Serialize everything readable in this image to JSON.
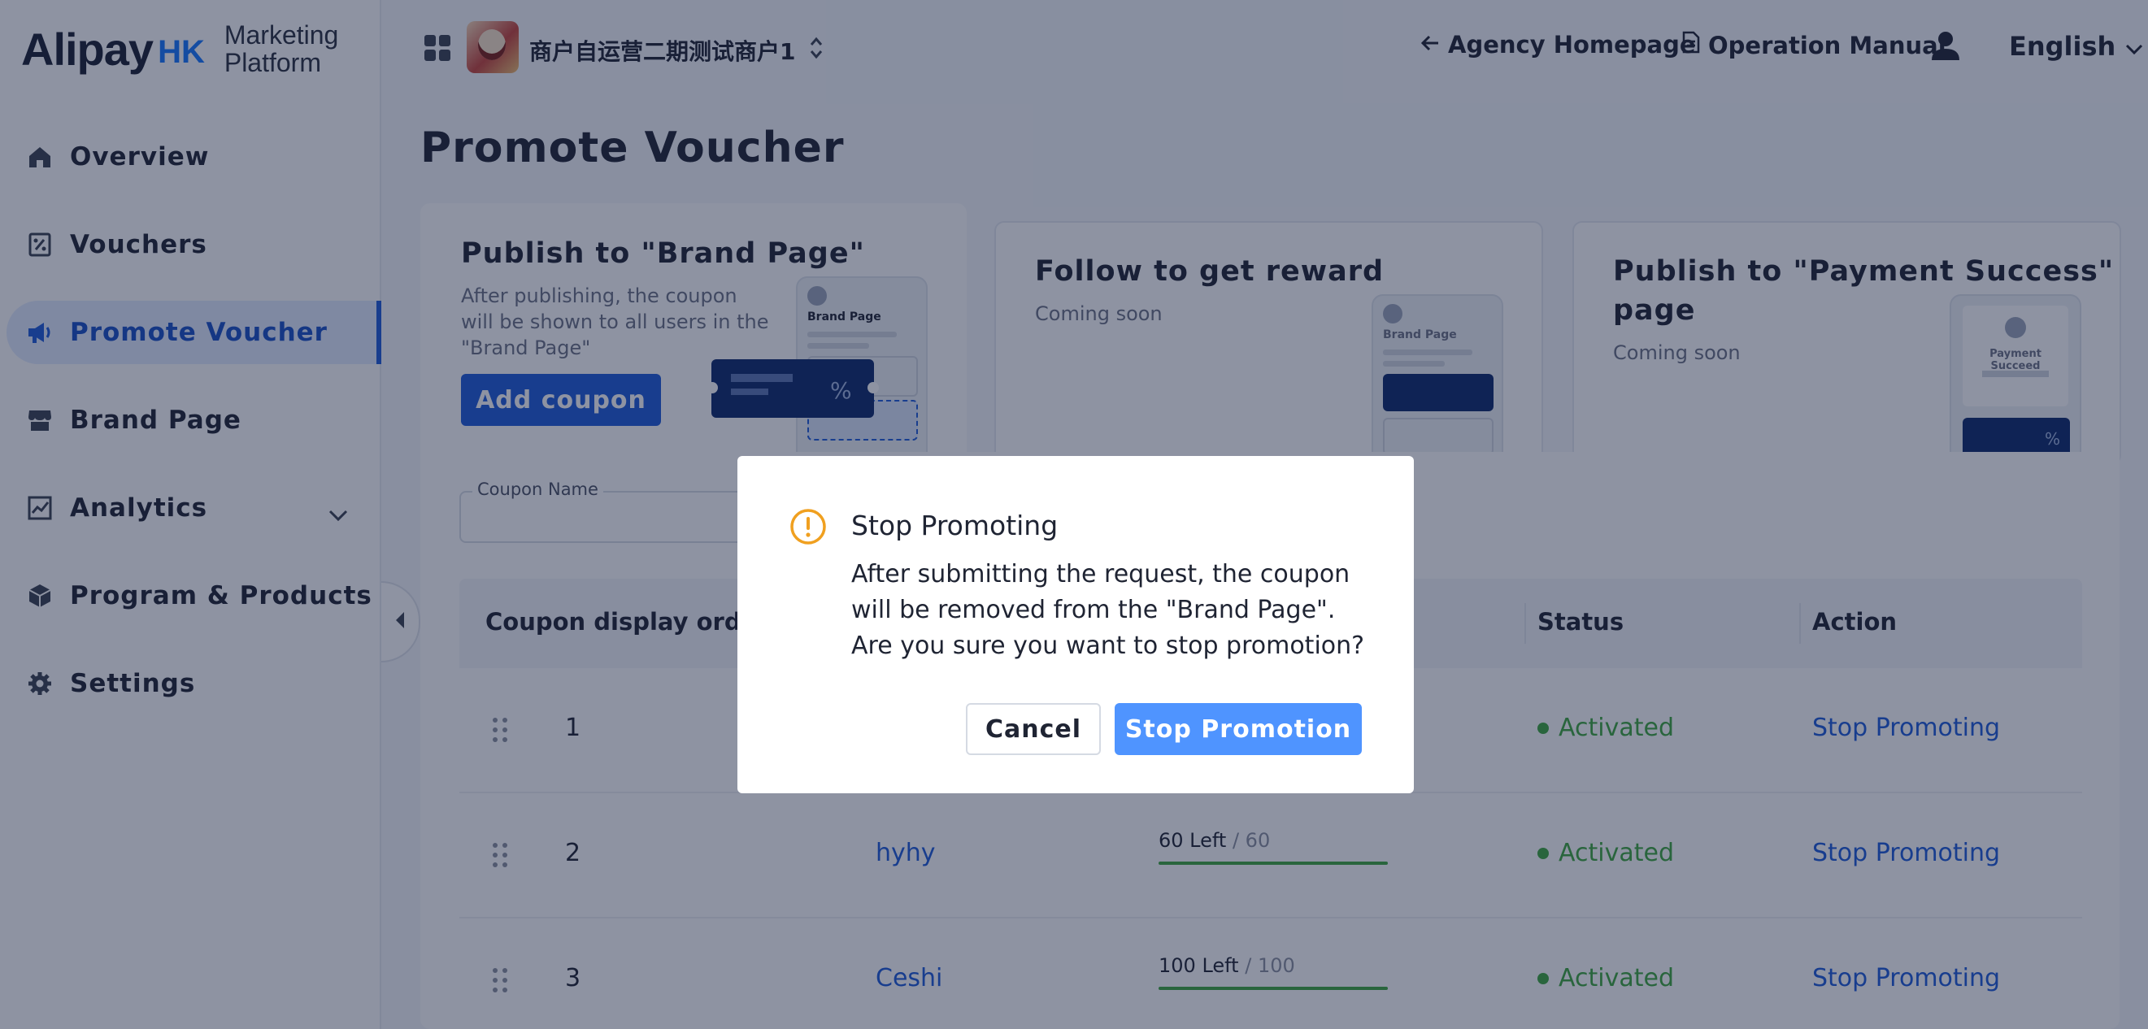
{
  "logo": {
    "main": "Alipay",
    "region": "HK",
    "sub_line1": "Marketing",
    "sub_line2": "Platform"
  },
  "sidebar": {
    "items": [
      {
        "label": "Overview",
        "icon": "home-icon"
      },
      {
        "label": "Vouchers",
        "icon": "voucher-icon"
      },
      {
        "label": "Promote Voucher",
        "icon": "megaphone-icon",
        "active": true
      },
      {
        "label": "Brand Page",
        "icon": "store-icon"
      },
      {
        "label": "Analytics",
        "icon": "chart-icon",
        "expandable": true
      },
      {
        "label": "Program & Products",
        "icon": "box-icon"
      },
      {
        "label": "Settings",
        "icon": "gear-icon"
      }
    ]
  },
  "header": {
    "store_name": "商户自运营二期测试商户1",
    "agency_link": "Agency Homepage",
    "manual_link": "Operation Manual",
    "language": "English"
  },
  "page": {
    "title": "Promote Voucher"
  },
  "cards": [
    {
      "title": "Publish to \"Brand Page\"",
      "desc": "After publishing, the coupon will be shown to all users in the \"Brand Page\"",
      "button": "Add coupon",
      "illustration_title": "Brand Page",
      "coupon_symbol": "%"
    },
    {
      "title": "Follow to get reward",
      "desc": "Coming soon",
      "illustration_title": "Brand Page"
    },
    {
      "title_line1": "Publish to \"Payment Success\"",
      "title_line2": "page",
      "desc": "Coming soon",
      "illustration_title": "Payment Succeed",
      "coupon_symbol": "%"
    }
  ],
  "filter": {
    "coupon_name_label": "Coupon Name"
  },
  "table": {
    "headers": {
      "order": "Coupon display order",
      "status": "Status",
      "action": "Action"
    },
    "rows": [
      {
        "order": "1",
        "name": "",
        "stock": "",
        "total": "",
        "fill": 1,
        "status": "Activated",
        "action": "Stop Promoting"
      },
      {
        "order": "2",
        "name": "hyhy",
        "stock": "60 Left",
        "total": " / 60",
        "fill": 1,
        "status": "Activated",
        "action": "Stop Promoting"
      },
      {
        "order": "3",
        "name": "Ceshi",
        "stock": "100 Left",
        "total": " / 100",
        "fill": 1,
        "status": "Activated",
        "action": "Stop Promoting"
      }
    ]
  },
  "modal": {
    "title": "Stop Promoting",
    "message": "After submitting the request, the coupon will be removed from the \"Brand Page\". Are you sure you want to stop promotion?",
    "cancel": "Cancel",
    "confirm": "Stop Promotion"
  },
  "colors": {
    "primary": "#1d5bd8",
    "confirm": "#4f94ff",
    "success": "#3fa83f",
    "warning": "#f0a020"
  }
}
